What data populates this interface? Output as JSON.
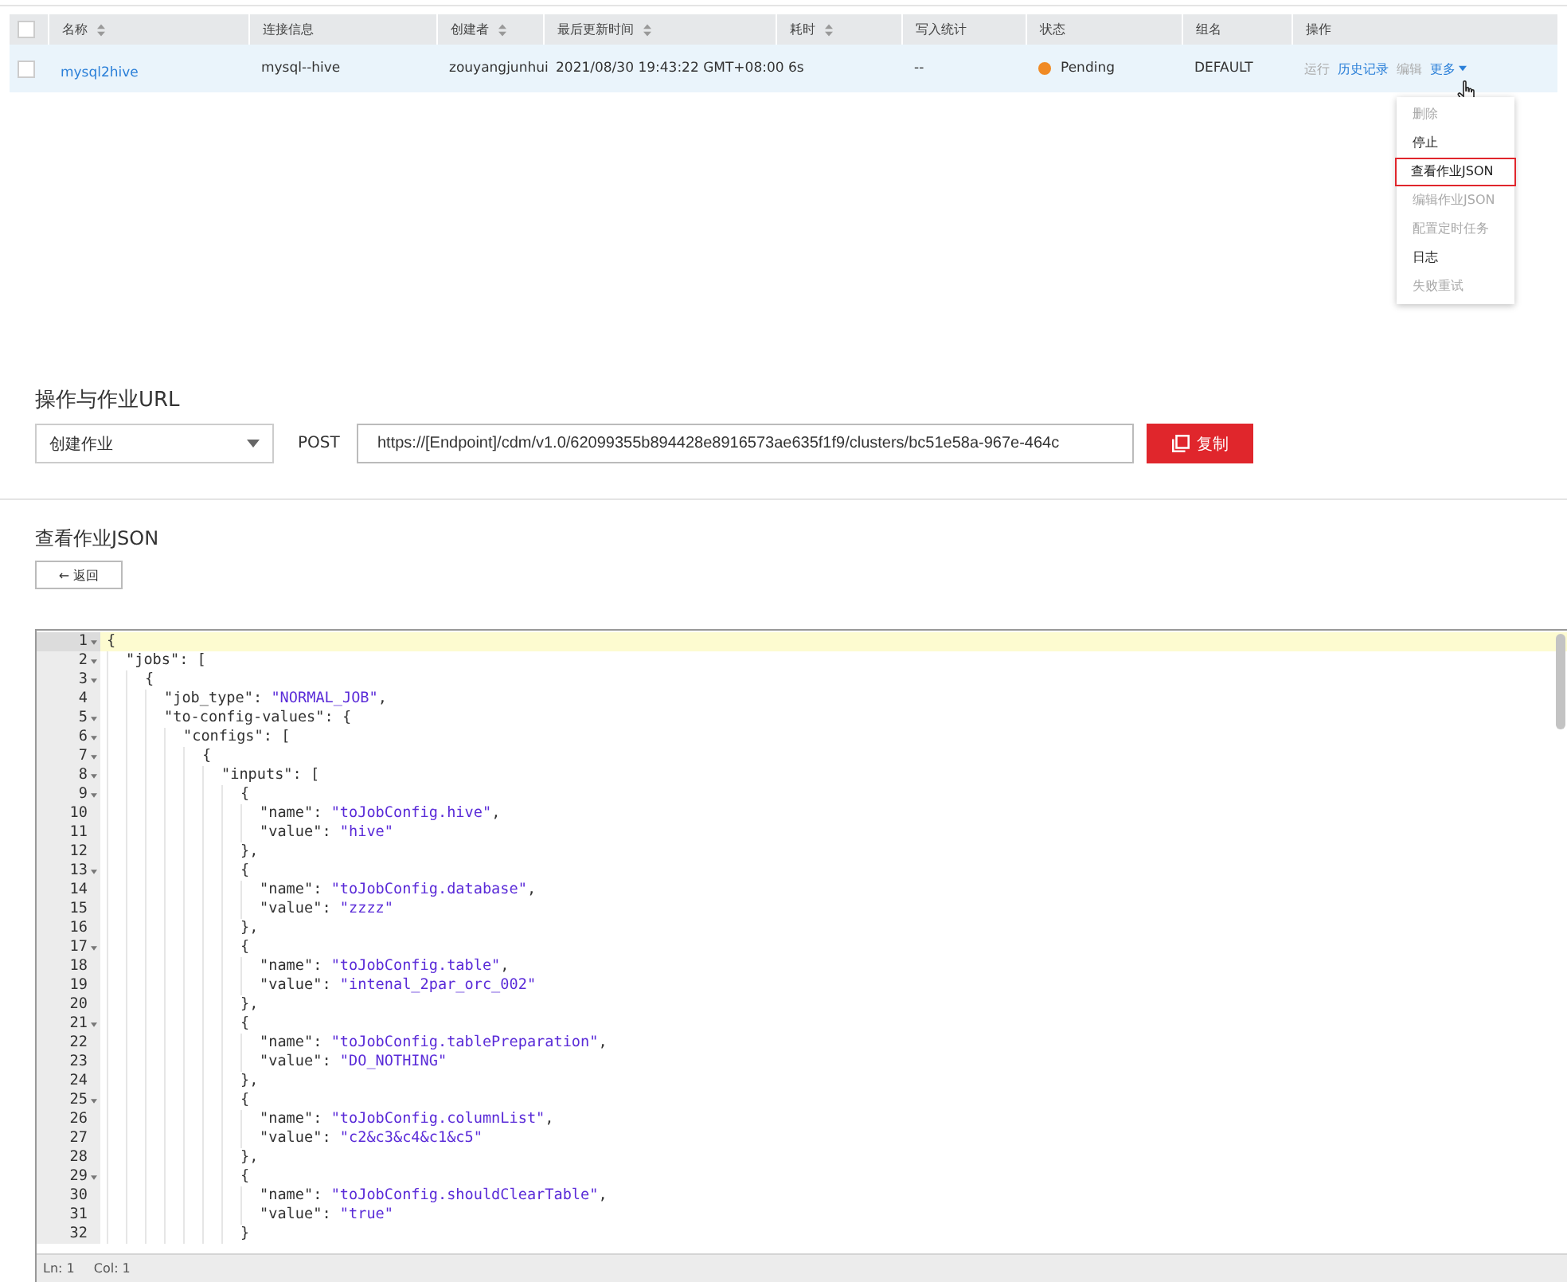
{
  "table": {
    "columns": [
      {
        "label": "名称",
        "sortable": true
      },
      {
        "label": "连接信息",
        "sortable": false
      },
      {
        "label": "创建者",
        "sortable": true
      },
      {
        "label": "最后更新时间",
        "sortable": true
      },
      {
        "label": "耗时",
        "sortable": true
      },
      {
        "label": "写入统计",
        "sortable": false
      },
      {
        "label": "状态",
        "sortable": false
      },
      {
        "label": "组名",
        "sortable": false
      },
      {
        "label": "操作",
        "sortable": false
      }
    ],
    "header_checked": false,
    "rows": [
      {
        "checked": false,
        "name": "mysql2hive",
        "connection": "mysql--hive",
        "creator": "zouyangjunhui",
        "updated": "2021/08/30 19:43:22 GMT+08:00",
        "duration": "6s",
        "written": "--",
        "status": "Pending",
        "group": "DEFAULT",
        "actions": [
          {
            "label": "运行",
            "disabled": true
          },
          {
            "label": "历史记录",
            "disabled": false
          },
          {
            "label": "编辑",
            "disabled": true
          }
        ],
        "more": "更多"
      }
    ]
  },
  "more_menu": [
    {
      "label": "删除",
      "disabled": true,
      "selected": false
    },
    {
      "label": "停止",
      "disabled": false,
      "selected": false
    },
    {
      "label": "查看作业JSON",
      "disabled": false,
      "selected": true
    },
    {
      "label": "编辑作业JSON",
      "disabled": true,
      "selected": false
    },
    {
      "label": "配置定时任务",
      "disabled": true,
      "selected": false
    },
    {
      "label": "日志",
      "disabled": false,
      "selected": false
    },
    {
      "label": "失败重试",
      "disabled": true,
      "selected": false
    }
  ],
  "url_section": {
    "title": "操作与作业URL",
    "operation": "创建作业",
    "method": "POST",
    "url": "https://[Endpoint]/cdm/v1.0/62099355b894428e8916573ae635f1f9/clusters/bc51e58a-967e-464c",
    "copy": "复制"
  },
  "json_section": {
    "title": "查看作业JSON",
    "back": "← 返回"
  },
  "editor": {
    "lines": [
      {
        "number": "1",
        "foldable": true,
        "text": "{"
      },
      {
        "number": "2",
        "foldable": true,
        "text": "  \"jobs\": ["
      },
      {
        "number": "3",
        "foldable": true,
        "text": "    {"
      },
      {
        "number": "4",
        "foldable": false,
        "text": "      \"job_type\": \"NORMAL_JOB\","
      },
      {
        "number": "5",
        "foldable": true,
        "text": "      \"to-config-values\": {"
      },
      {
        "number": "6",
        "foldable": true,
        "text": "        \"configs\": ["
      },
      {
        "number": "7",
        "foldable": true,
        "text": "          {"
      },
      {
        "number": "8",
        "foldable": true,
        "text": "            \"inputs\": ["
      },
      {
        "number": "9",
        "foldable": true,
        "text": "              {"
      },
      {
        "number": "10",
        "foldable": false,
        "text": "                \"name\": \"toJobConfig.hive\","
      },
      {
        "number": "11",
        "foldable": false,
        "text": "                \"value\": \"hive\""
      },
      {
        "number": "12",
        "foldable": false,
        "text": "              },"
      },
      {
        "number": "13",
        "foldable": true,
        "text": "              {"
      },
      {
        "number": "14",
        "foldable": false,
        "text": "                \"name\": \"toJobConfig.database\","
      },
      {
        "number": "15",
        "foldable": false,
        "text": "                \"value\": \"zzzz\""
      },
      {
        "number": "16",
        "foldable": false,
        "text": "              },"
      },
      {
        "number": "17",
        "foldable": true,
        "text": "              {"
      },
      {
        "number": "18",
        "foldable": false,
        "text": "                \"name\": \"toJobConfig.table\","
      },
      {
        "number": "19",
        "foldable": false,
        "text": "                \"value\": \"intenal_2par_orc_002\""
      },
      {
        "number": "20",
        "foldable": false,
        "text": "              },"
      },
      {
        "number": "21",
        "foldable": true,
        "text": "              {"
      },
      {
        "number": "22",
        "foldable": false,
        "text": "                \"name\": \"toJobConfig.tablePreparation\","
      },
      {
        "number": "23",
        "foldable": false,
        "text": "                \"value\": \"DO_NOTHING\""
      },
      {
        "number": "24",
        "foldable": false,
        "text": "              },"
      },
      {
        "number": "25",
        "foldable": true,
        "text": "              {"
      },
      {
        "number": "26",
        "foldable": false,
        "text": "                \"name\": \"toJobConfig.columnList\","
      },
      {
        "number": "27",
        "foldable": false,
        "text": "                \"value\": \"c2&c3&c4&c1&c5\""
      },
      {
        "number": "28",
        "foldable": false,
        "text": "              },"
      },
      {
        "number": "29",
        "foldable": true,
        "text": "              {"
      },
      {
        "number": "30",
        "foldable": false,
        "text": "                \"name\": \"toJobConfig.shouldClearTable\","
      },
      {
        "number": "31",
        "foldable": false,
        "text": "                \"value\": \"true\""
      },
      {
        "number": "32",
        "foldable": false,
        "text": "              }"
      }
    ],
    "status": {
      "line": "Ln: 1",
      "col": "Col: 1"
    }
  }
}
